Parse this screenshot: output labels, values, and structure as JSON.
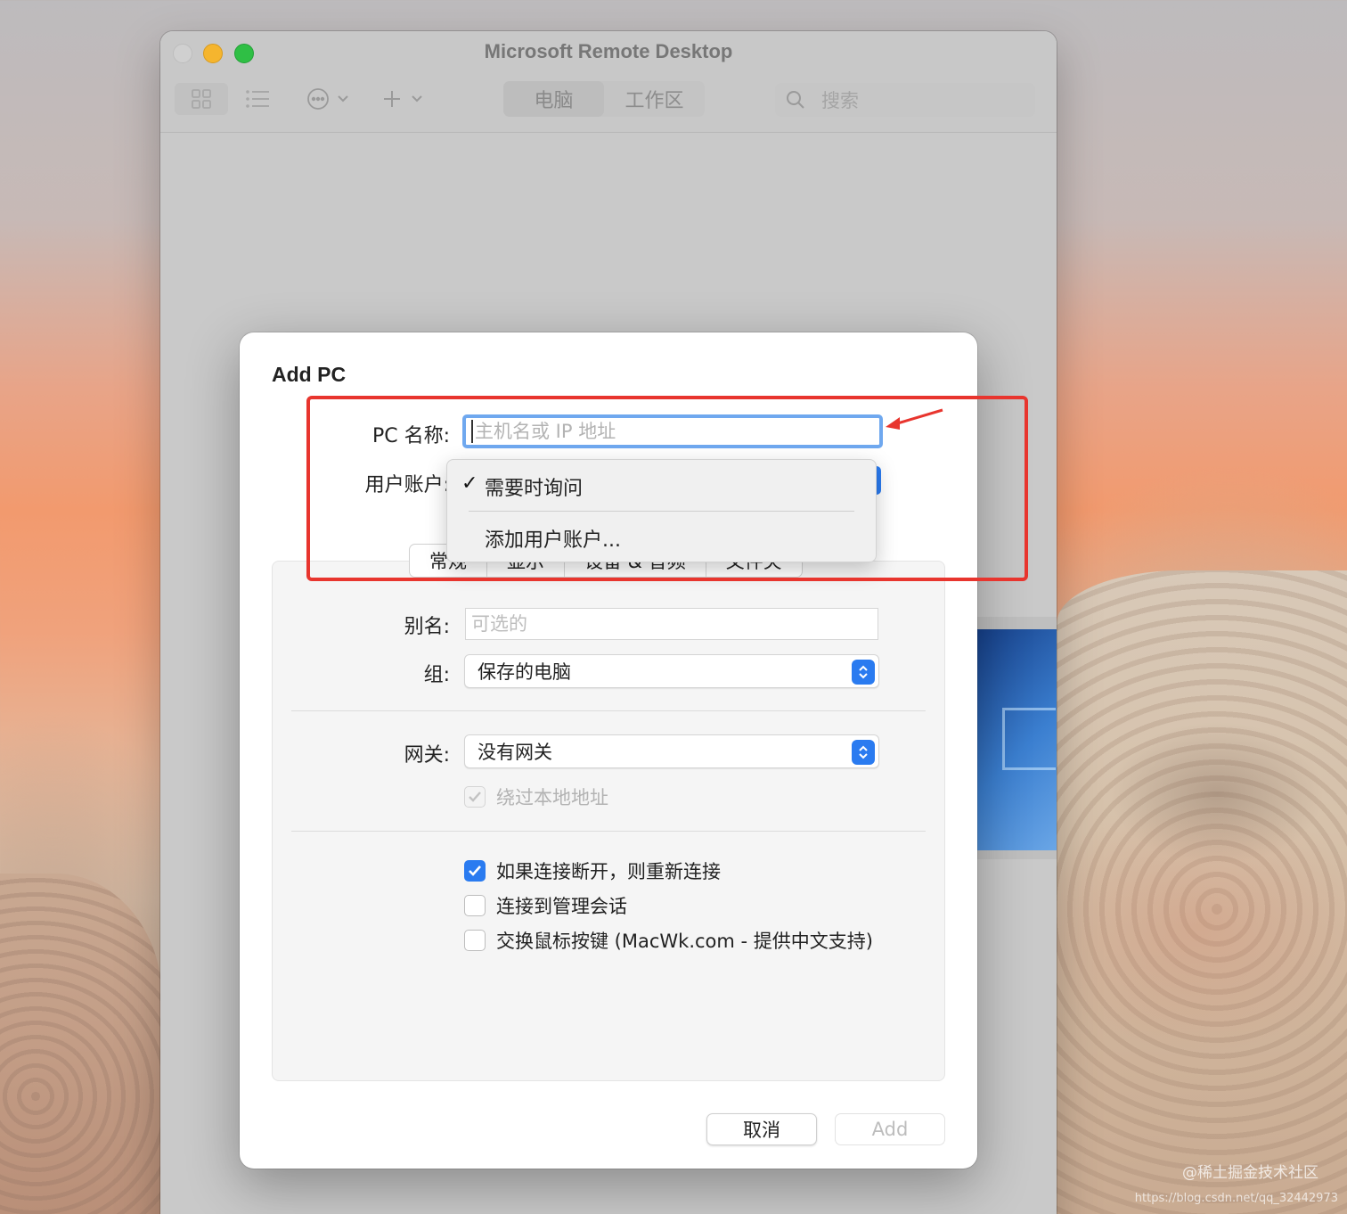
{
  "window": {
    "title": "Microsoft Remote Desktop",
    "segments": [
      "电脑",
      "工作区"
    ],
    "search_placeholder": "搜索"
  },
  "dialog": {
    "title": "Add PC",
    "pc_name_label": "PC 名称:",
    "pc_name_placeholder": "主机名或 IP 地址",
    "user_account_label": "用户账户:",
    "tabs": [
      "常规",
      "显示",
      "设备 & 音频",
      "文件夹"
    ],
    "alias_label": "别名:",
    "alias_placeholder": "可选的",
    "group_label": "组:",
    "group_value": "保存的电脑",
    "gateway_label": "网关:",
    "gateway_value": "没有网关",
    "bypass_local": "绕过本地地址",
    "reconnect": "如果连接断开，则重新连接",
    "admin_session": "连接到管理会话",
    "swap_mouse": "交换鼠标按键 (MacWk.com - 提供中文支持)",
    "cancel": "取消",
    "add": "Add"
  },
  "menu": {
    "items": [
      "需要时询问",
      "添加用户账户..."
    ],
    "checked_index": 0
  },
  "watermark": {
    "text": "@稀土掘金技术社区",
    "url": "https://blog.csdn.net/qq_32442973"
  },
  "colors": {
    "accent": "#2a7bf0",
    "annotation": "#e8352e",
    "focus_ring": "#6fa8ef"
  }
}
